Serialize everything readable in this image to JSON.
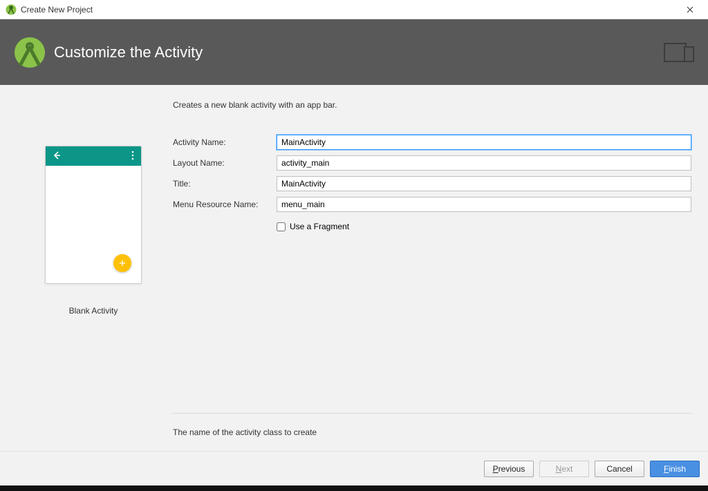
{
  "window": {
    "title": "Create New Project"
  },
  "banner": {
    "heading": "Customize the Activity"
  },
  "preview": {
    "template_label": "Blank Activity"
  },
  "form": {
    "description": "Creates a new blank activity with an app bar.",
    "labels": {
      "activity_name": "Activity Name:",
      "layout_name": "Layout Name:",
      "title": "Title:",
      "menu_resource_name": "Menu Resource Name:",
      "use_fragment": "Use a Fragment"
    },
    "values": {
      "activity_name": "MainActivity",
      "layout_name": "activity_main",
      "title": "MainActivity",
      "menu_resource_name": "menu_main",
      "use_fragment": false
    },
    "hint": "The name of the activity class to create"
  },
  "buttons": {
    "previous": "Previous",
    "next": "Next",
    "cancel": "Cancel",
    "finish": "Finish"
  }
}
